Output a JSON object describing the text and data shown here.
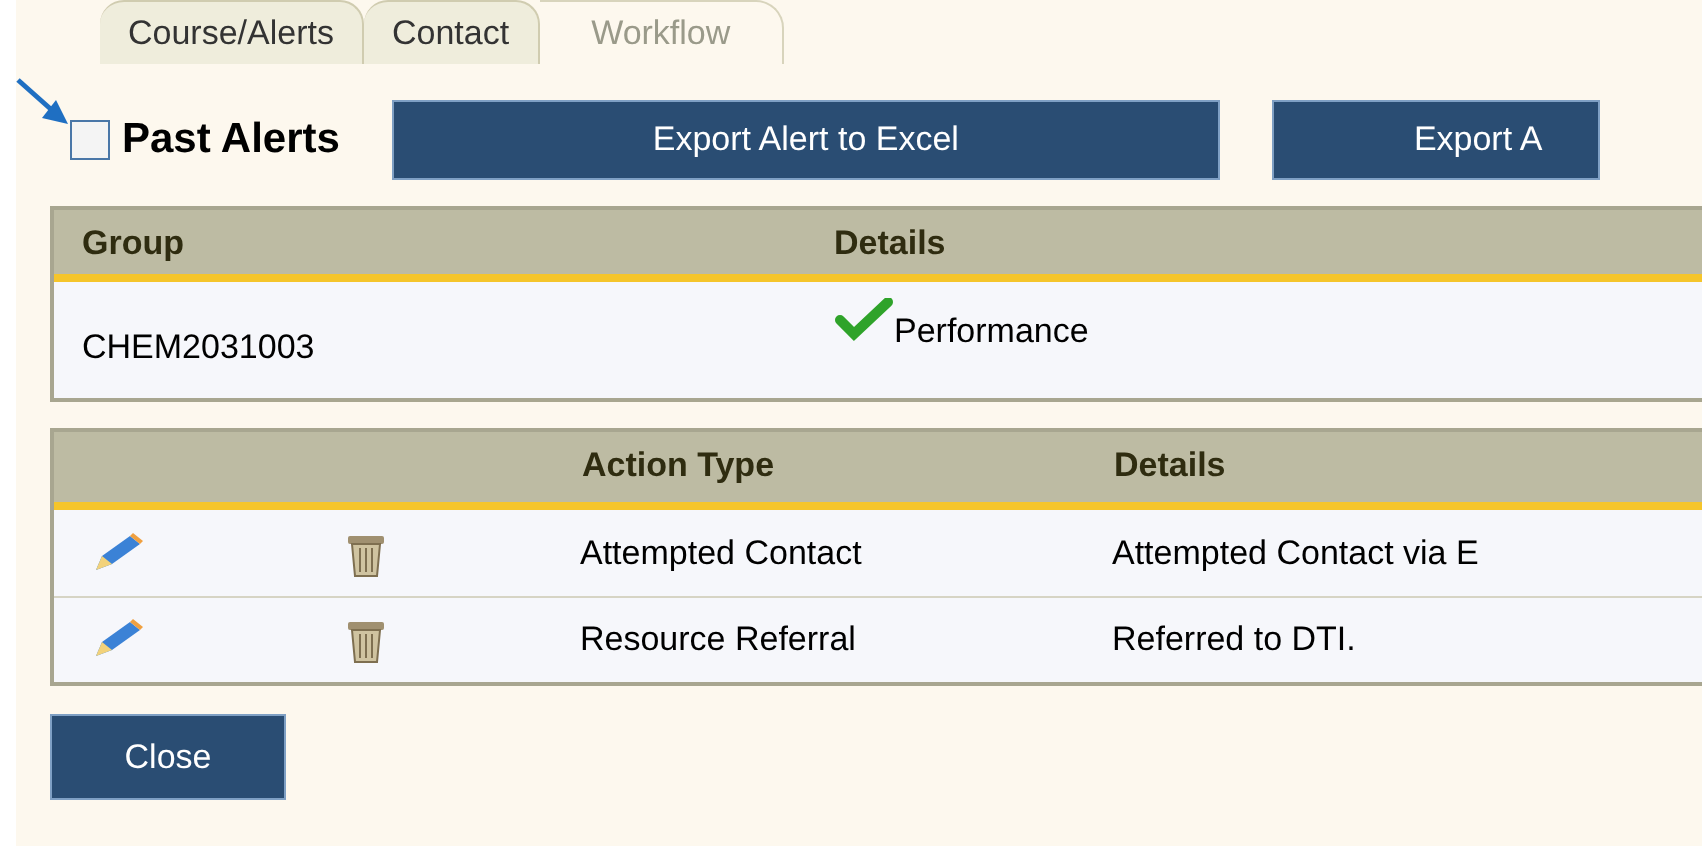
{
  "tabs": [
    {
      "label": "Course/Alerts",
      "selected": false
    },
    {
      "label": "Contact",
      "selected": false
    },
    {
      "label": "Workflow",
      "selected": true
    }
  ],
  "past_alerts": {
    "label": "Past Alerts",
    "checked": false
  },
  "buttons": [
    "Export Alert to Excel",
    "Export A"
  ],
  "alerts_table": {
    "columns": [
      "Group",
      "Details"
    ],
    "rows": [
      {
        "group": "CHEM2031003",
        "details": "Performance",
        "ok": true
      }
    ]
  },
  "actions_table": {
    "columns": [
      "Action Type",
      "Details"
    ],
    "rows": [
      {
        "action_type": "Attempted Contact",
        "details": "Attempted Contact via E"
      },
      {
        "action_type": "Resource Referral",
        "details": "Referred to DTI."
      }
    ]
  },
  "close_button": "Close"
}
